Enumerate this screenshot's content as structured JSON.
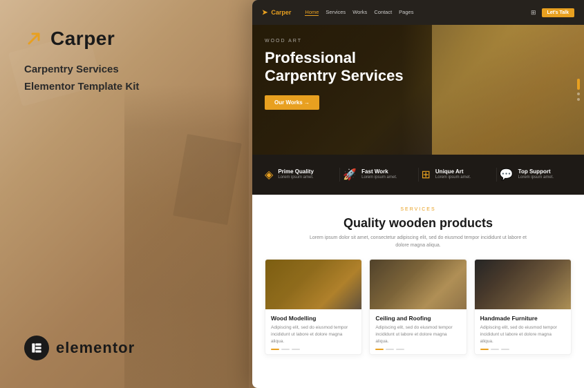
{
  "left": {
    "brand": {
      "name": "Carper",
      "description_line1": "Carpentry Services",
      "description_line2": "Elementor Template Kit"
    },
    "elementor": {
      "label": "elementor"
    }
  },
  "navbar": {
    "logo": "Carper",
    "links": [
      {
        "label": "Home",
        "active": true
      },
      {
        "label": "Services",
        "active": false
      },
      {
        "label": "Works",
        "active": false
      },
      {
        "label": "Contact",
        "active": false
      },
      {
        "label": "Pages",
        "active": false
      }
    ],
    "cta": "Let's Talk"
  },
  "hero": {
    "tag": "WOOD ART",
    "title_line1": "Professional",
    "title_line2": "Carpentry Services",
    "button": "Our Works →"
  },
  "features": [
    {
      "icon": "◈",
      "title": "Prime Quality",
      "desc": "Lorem ipsum amet."
    },
    {
      "icon": "🚀",
      "title": "Fast Work",
      "desc": "Lorem ipsum amet."
    },
    {
      "icon": "⊞",
      "title": "Unique Art",
      "desc": "Lorem ipsum amet."
    },
    {
      "icon": "💬",
      "title": "Top Support",
      "desc": "Lorem ipsum amet."
    }
  ],
  "services": {
    "label": "SERVICES",
    "title": "Quality wooden products",
    "desc": "Lorem ipsum dolor sit amet, consectetur adipiscing elit, sed do eiusmod tempor incididunt ut labore et dolore magna aliqua.",
    "cards": [
      {
        "title": "Wood Modelling",
        "text": "Adipiscing elit, sed do eiusmod tempor incididunt ut labore et dolore magna aliqua."
      },
      {
        "title": "Ceiling and Roofing",
        "text": "Adipiscing elit, sed do eiusmod tempor incididunt ut labore et dolore magna aliqua."
      },
      {
        "title": "Handmade Furniture",
        "text": "Adipiscing elit, sed do eiusmod tempor incididunt ut labore et dolore magna aliqua."
      }
    ]
  },
  "colors": {
    "accent": "#e8a020",
    "dark": "#1a1a1a",
    "mid": "#555"
  }
}
